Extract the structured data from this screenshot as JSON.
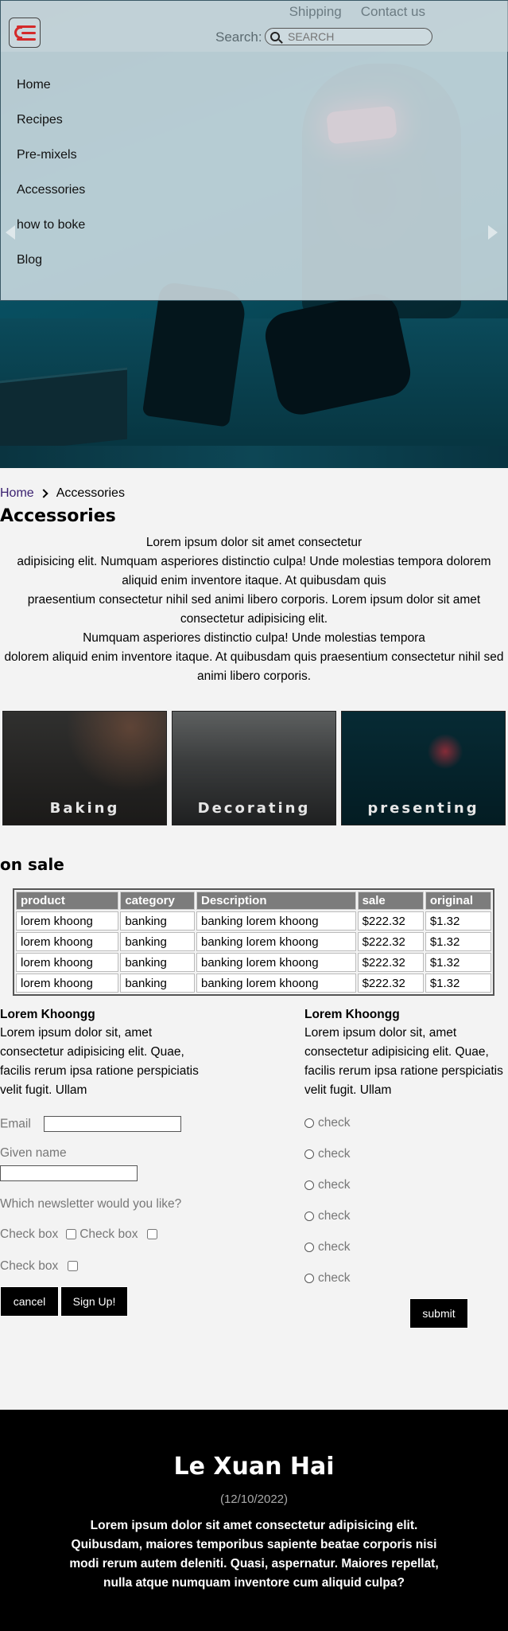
{
  "header": {
    "top_links": [
      "Shipping",
      "Contact us"
    ],
    "search_label": "Search:",
    "search_placeholder": "SEARCH"
  },
  "nav": {
    "items": [
      "Home",
      "Recipes",
      "Pre-mixels",
      "Accessories",
      "how to boke",
      "Blog"
    ]
  },
  "breadcrumb": {
    "home": "Home",
    "current": "Accessories"
  },
  "page": {
    "title": "Accessories",
    "intro_lines": [
      "Lorem ipsum dolor sit amet consectetur",
      "adipisicing elit. Numquam asperiores distinctio culpa! Unde molestias tempora dolorem aliquid enim inventore itaque. At quibusdam quis",
      "praesentium consectetur nihil sed animi libero corporis. Lorem ipsum dolor sit amet consectetur adipisicing elit.",
      "Numquam asperiores distinctio culpa! Unde molestias tempora",
      "dolorem aliquid enim inventore itaque. At quibusdam quis praesentium consectetur nihil sed animi libero corporis."
    ]
  },
  "categories": [
    "Baking",
    "Decorating",
    "presenting"
  ],
  "sale": {
    "title": "on sale",
    "columns": [
      "product",
      "category",
      "Description",
      "sale",
      "original"
    ],
    "rows": [
      [
        "lorem khoong",
        "banking",
        "banking lorem khoong",
        "$222.32",
        "$1.32"
      ],
      [
        "lorem khoong",
        "banking",
        "banking lorem khoong",
        "$222.32",
        "$1.32"
      ],
      [
        "lorem khoong",
        "banking",
        "banking lorem khoong",
        "$222.32",
        "$1.32"
      ],
      [
        "lorem khoong",
        "banking",
        "banking lorem khoong",
        "$222.32",
        "$1.32"
      ]
    ]
  },
  "info_left": {
    "title": "Lorem Khoongg",
    "text": "Lorem ipsum dolor sit, amet consectetur adipisicing elit. Quae, facilis rerum ipsa ratione perspiciatis velit fugit. Ullam"
  },
  "info_right": {
    "title": "Lorem Khoongg",
    "text": "Lorem ipsum dolor sit, amet consectetur adipisicing elit. Quae, facilis rerum ipsa ratione perspiciatis velit fugit. Ullam"
  },
  "form": {
    "email_label": "Email",
    "given_name_label": "Given name",
    "newsletter_question": "Which newsletter would you like?",
    "checkbox_label": "Check box",
    "cancel": "cancel",
    "signup": "Sign Up!",
    "submit": "submit"
  },
  "checks": [
    "check",
    "check",
    "check",
    "check",
    "check",
    "check"
  ],
  "footer": {
    "name": "Le Xuan Hai",
    "date": "(12/10/2022)",
    "description": "Lorem ipsum dolor sit amet consectetur adipisicing elit. Quibusdam, maiores temporibus sapiente beatae corporis nisi modi rerum autem deleniti. Quasi, aspernatur. Maiores repellat, nulla atque numquam inventore cum aliquid culpa?"
  },
  "colors": {
    "menu_icon": "#d42a2a",
    "breadcrumb_link": "#3b2170",
    "table_header": "#7c7c7c",
    "footer_bg": "#000000"
  }
}
